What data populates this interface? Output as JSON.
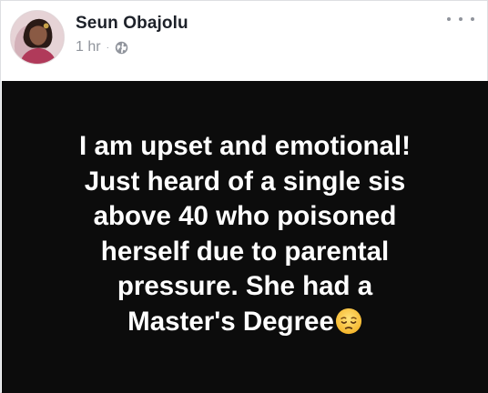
{
  "post": {
    "author": "Seun Obajolu",
    "timestamp": "1 hr",
    "separator": "·",
    "privacy_icon": "globe-icon",
    "more_icon": "more-options-icon",
    "status": {
      "background_color": "#0c0c0c",
      "text_color": "#ffffff",
      "lines": [
        "I am upset and emotional!",
        "Just heard of a single sis",
        "above 40 who poisoned",
        "herself due to parental",
        "pressure.  She had a",
        "Master's Degree"
      ],
      "trailing_emoji": "pensive-face-emoji"
    }
  }
}
